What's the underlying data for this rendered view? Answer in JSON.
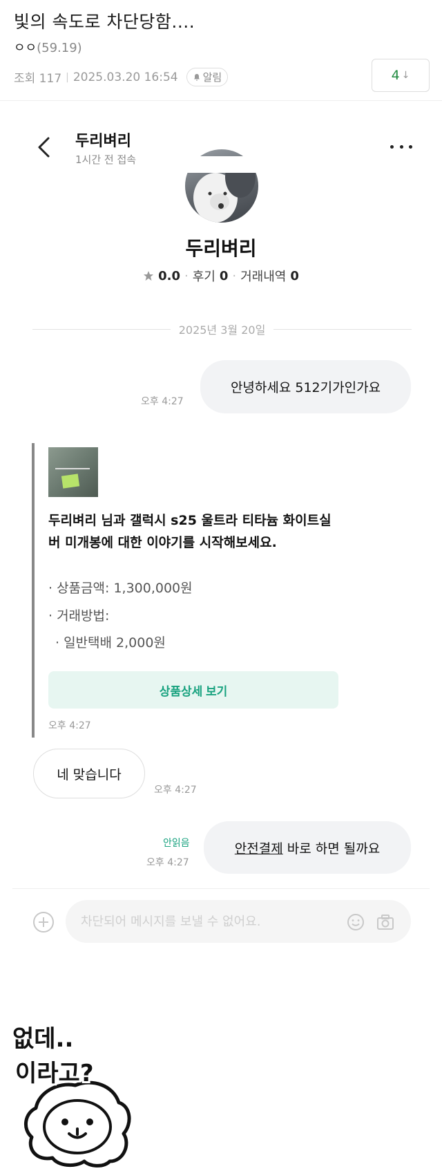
{
  "post": {
    "title": "빛의 속도로 차단당함....",
    "author": "ㅇㅇ",
    "author_score": "(59.19)",
    "views_label": "조회 117",
    "date": "2025.03.20 16:54",
    "alarm_label": "알림",
    "comment_count": "4",
    "comment_arrow": "↓",
    "accent_color": "#1f8a3f"
  },
  "chat": {
    "name": "두리벼리",
    "status": "1시간 전 접속"
  },
  "profile": {
    "name": "두리벼리",
    "rating": "0.0",
    "reviews_label": "후기",
    "reviews": "0",
    "trades_label": "거래내역",
    "trades": "0"
  },
  "date_divider": "2025년 3월 20일",
  "messages": {
    "m1": {
      "text": "안녕하세요 512기가인가요",
      "time": "오후 4:27"
    },
    "product": {
      "description": "두리벼리 님과 갤럭시 s25 울트라 티타늄 화이트실버 미개봉에 대한 이야기를 시작해보세요.",
      "price_line": "· 상품금액: 1,300,000원",
      "method_line": "· 거래방법:",
      "shipping_line": "· 일반택배 2,000원",
      "detail_button": "상품상세 보기",
      "time": "오후 4:27",
      "accent_color": "#18a27f"
    },
    "m2": {
      "text": "네 맞습니다",
      "time": "오후 4:27"
    },
    "m3": {
      "underlined": "안전결제",
      "rest": " 바로 하면 될까요",
      "unread": "안읽음",
      "time": "오후 4:27"
    }
  },
  "input": {
    "placeholder": "차단되어 메시지를 보낼 수 없어요."
  },
  "sticker": {
    "line1": "없데..",
    "line2": "이라고?"
  }
}
